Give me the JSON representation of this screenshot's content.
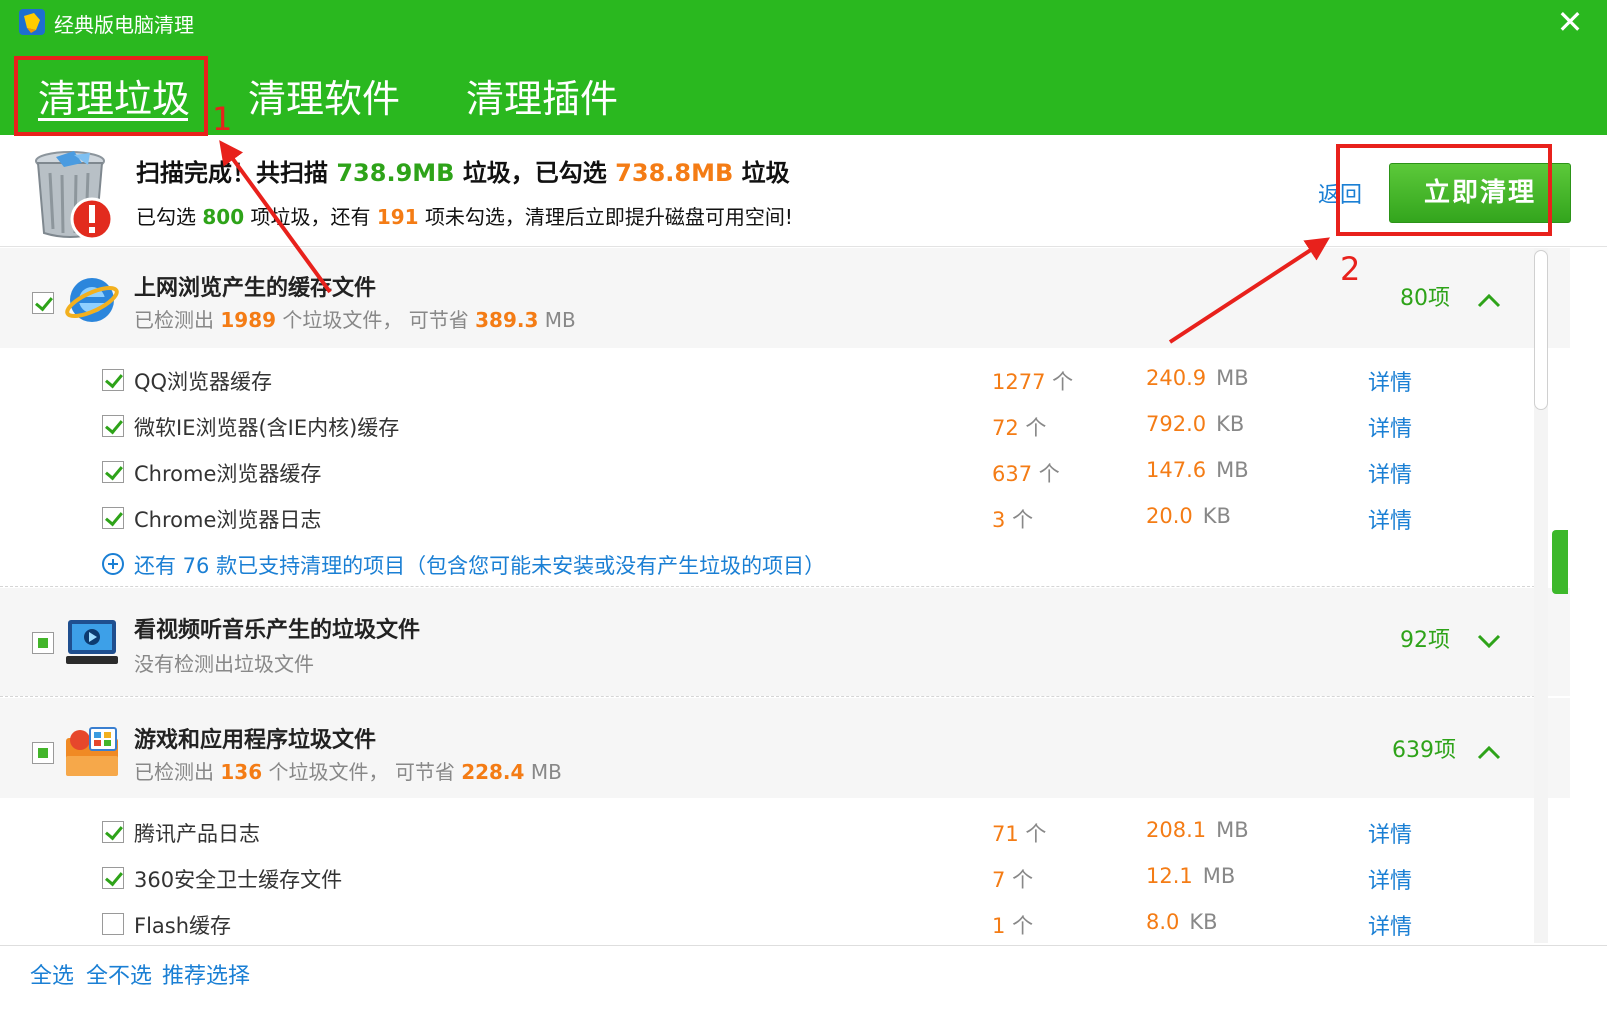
{
  "window": {
    "title": "经典版电脑清理",
    "close_glyph": "✕"
  },
  "tabs": [
    {
      "label": "清理垃圾",
      "active": true
    },
    {
      "label": "清理软件",
      "active": false
    },
    {
      "label": "清理插件",
      "active": false
    }
  ],
  "annotations": {
    "box1_label": "1",
    "box2_label": "2"
  },
  "summary": {
    "line1_prefix": "扫描完成！共扫描",
    "scanned_size": "738.9MB",
    "line1_mid": "垃圾，已勾选",
    "selected_size": "738.8MB",
    "line1_suffix": "垃圾",
    "line2_prefix": "已勾选",
    "selected_items": "800",
    "line2_mid": "项垃圾，还有",
    "unselected_items": "191",
    "line2_suffix": "项未勾选，清理后立即提升磁盘可用空间!",
    "back_label": "返回",
    "clean_button_label": "立即清理"
  },
  "groups": [
    {
      "title": "上网浏览产生的缓存文件",
      "desc_prefix": "已检测出",
      "desc_count": "1989",
      "desc_mid": "个垃圾文件， 可节省",
      "desc_size": "389.3",
      "desc_unit": "MB",
      "count_label": "80项",
      "icon": "ie-browser-icon",
      "items": [
        {
          "label": "QQ浏览器缓存",
          "count": "1277",
          "count_unit": "个",
          "size": "240.9",
          "size_unit": "MB",
          "detail": "详情",
          "checked": true
        },
        {
          "label": "微软IE浏览器(含IE内核)缓存",
          "count": "72",
          "count_unit": "个",
          "size": "792.0",
          "size_unit": "KB",
          "detail": "详情",
          "checked": true
        },
        {
          "label": "Chrome浏览器缓存",
          "count": "637",
          "count_unit": "个",
          "size": "147.6",
          "size_unit": "MB",
          "detail": "详情",
          "checked": true
        },
        {
          "label": "Chrome浏览器日志",
          "count": "3",
          "count_unit": "个",
          "size": "20.0",
          "size_unit": "KB",
          "detail": "详情",
          "checked": true
        }
      ],
      "more_label": "还有 76 款已支持清理的项目（包含您可能未安装或没有产生垃圾的项目）"
    },
    {
      "title": "看视频听音乐产生的垃圾文件",
      "desc_text": "没有检测出垃圾文件",
      "count_label": "92项",
      "icon": "video-player-icon"
    },
    {
      "title": "游戏和应用程序垃圾文件",
      "desc_prefix": "已检测出",
      "desc_count": "136",
      "desc_mid": "个垃圾文件， 可节省",
      "desc_size": "228.4",
      "desc_unit": "MB",
      "count_label": "639项",
      "icon": "apps-folder-icon",
      "items": [
        {
          "label": "腾讯产品日志",
          "count": "71",
          "count_unit": "个",
          "size": "208.1",
          "size_unit": "MB",
          "detail": "详情",
          "checked": true
        },
        {
          "label": "360安全卫士缓存文件",
          "count": "7",
          "count_unit": "个",
          "size": "12.1",
          "size_unit": "MB",
          "detail": "详情",
          "checked": true
        },
        {
          "label": "Flash缓存",
          "count": "1",
          "count_unit": "个",
          "size": "8.0",
          "size_unit": "KB",
          "detail": "详情",
          "checked": false
        }
      ]
    }
  ],
  "footer": {
    "select_all": "全选",
    "select_none": "全不选",
    "recommended": "推荐选择"
  },
  "colors": {
    "brand_green": "#2ab81f",
    "accent_orange": "#f47c15",
    "link_blue": "#1a7fd4",
    "annotation_red": "#e8211c"
  }
}
